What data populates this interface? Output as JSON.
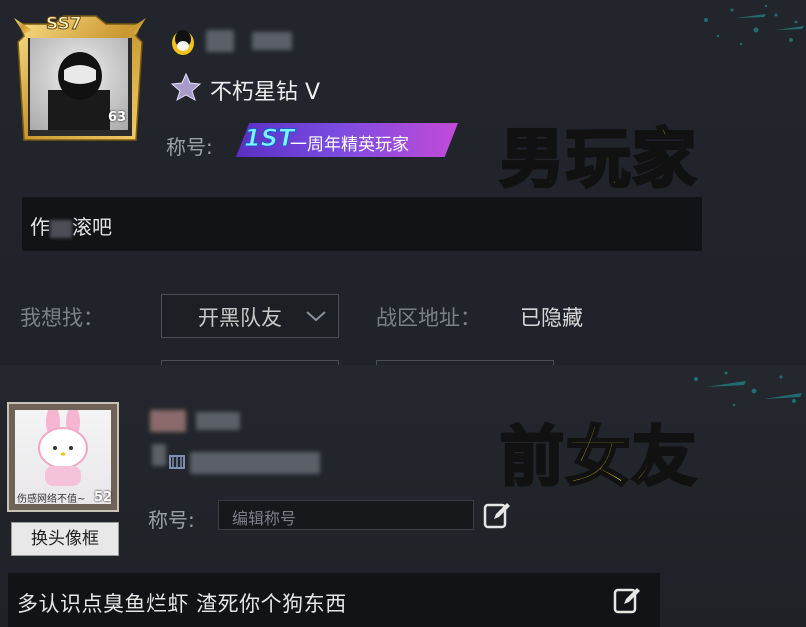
{
  "overlay_labels": {
    "top": "男玩家",
    "bottom": "前女友"
  },
  "top_profile": {
    "frame_badge": "SS7",
    "level": "63",
    "rank": "不朽星钻 V",
    "title_label": "称号:",
    "title_badge_logo": "1ST",
    "title_badge_text": "一周年精英玩家",
    "comment_prefix": "作",
    "comment_suffix": "滚吧"
  },
  "form": {
    "looking_for_label": "我想找：",
    "looking_for_value": "开黑队友",
    "region_label": "战区地址：",
    "region_value": "已隐藏"
  },
  "bottom_profile": {
    "level": "52",
    "frame_caption": "伤感网络不值~",
    "change_frame_button": "换头像框",
    "title_label": "称号:",
    "title_placeholder": "编辑称号",
    "comment": "多认识点臭鱼烂虾 渣死你个狗东西"
  },
  "colors": {
    "overlay_yellow": "#f6e50e",
    "gold_frame": "#d8b24a",
    "title_badge_purple": "#7a4be0",
    "splatter_teal": "#1fa7a8"
  },
  "icons": [
    "qq-penguin-icon",
    "rank-star-icon",
    "chevron-down-icon",
    "edit-icon",
    "rank-small-icon"
  ]
}
